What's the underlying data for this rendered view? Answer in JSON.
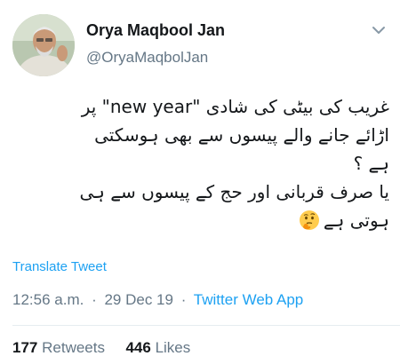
{
  "tweet": {
    "display_name": "Orya Maqbool Jan",
    "handle": "@OryaMaqbolJan",
    "text_lines": [
      "غریب کی بیٹی کی شادی \"new year\" پر",
      "اڑائے جانے والے پیسوں سے بھی ہوسکتی",
      "ہے ؟",
      "یا صرف قربانی اور حج کے پیسوں سے ہی",
      "ہوتی ہے"
    ],
    "emoji_icon": "thinking-face-icon",
    "translate_label": "Translate Tweet",
    "time": "12:56 a.m.",
    "date": "29 Dec 19",
    "separator": "·",
    "source": "Twitter Web App",
    "retweets_count": "177",
    "retweets_label": "Retweets",
    "likes_count": "446",
    "likes_label": "Likes"
  },
  "colors": {
    "accent": "#1da1f2",
    "secondary_text": "#657786",
    "primary_text": "#14171a"
  }
}
